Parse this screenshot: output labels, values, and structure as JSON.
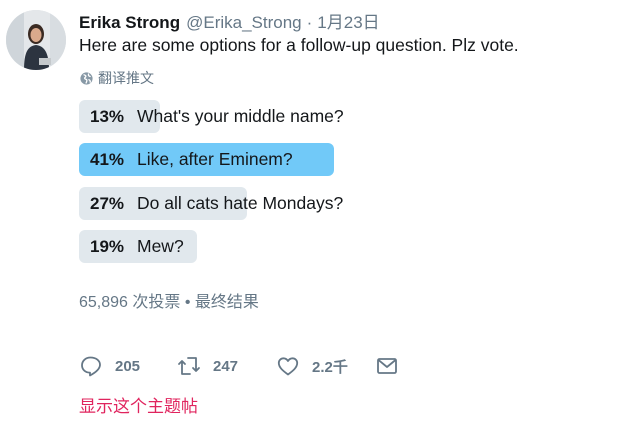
{
  "tweet": {
    "author_name": "Erika Strong",
    "author_handle": "@Erika_Strong",
    "separator": "·",
    "date": "1月23日",
    "text": "Here are some options for a follow-up question. Plz vote.",
    "translate_label": "翻译推文"
  },
  "poll": {
    "options": [
      {
        "percent": "13%",
        "value": 13,
        "label": "What's your middle name?",
        "winner": false
      },
      {
        "percent": "41%",
        "value": 41,
        "label": "Like, after Eminem?",
        "winner": true
      },
      {
        "percent": "27%",
        "value": 27,
        "label": "Do all cats hate Mondays?",
        "winner": false
      },
      {
        "percent": "19%",
        "value": 19,
        "label": "Mew?",
        "winner": false
      }
    ],
    "summary": "65,896 次投票 • 最终结果"
  },
  "actions": {
    "reply_count": "205",
    "retweet_count": "247",
    "like_count": "2.2千"
  },
  "show_thread_label": "显示这个主题帖",
  "colors": {
    "winner_bar": "#71c9f8",
    "bar": "#e1e8ed",
    "secondary_text": "#657786",
    "thread_link": "#e0245e"
  },
  "icons": [
    "globe-icon",
    "reply-icon",
    "retweet-icon",
    "like-icon",
    "direct-message-icon"
  ]
}
